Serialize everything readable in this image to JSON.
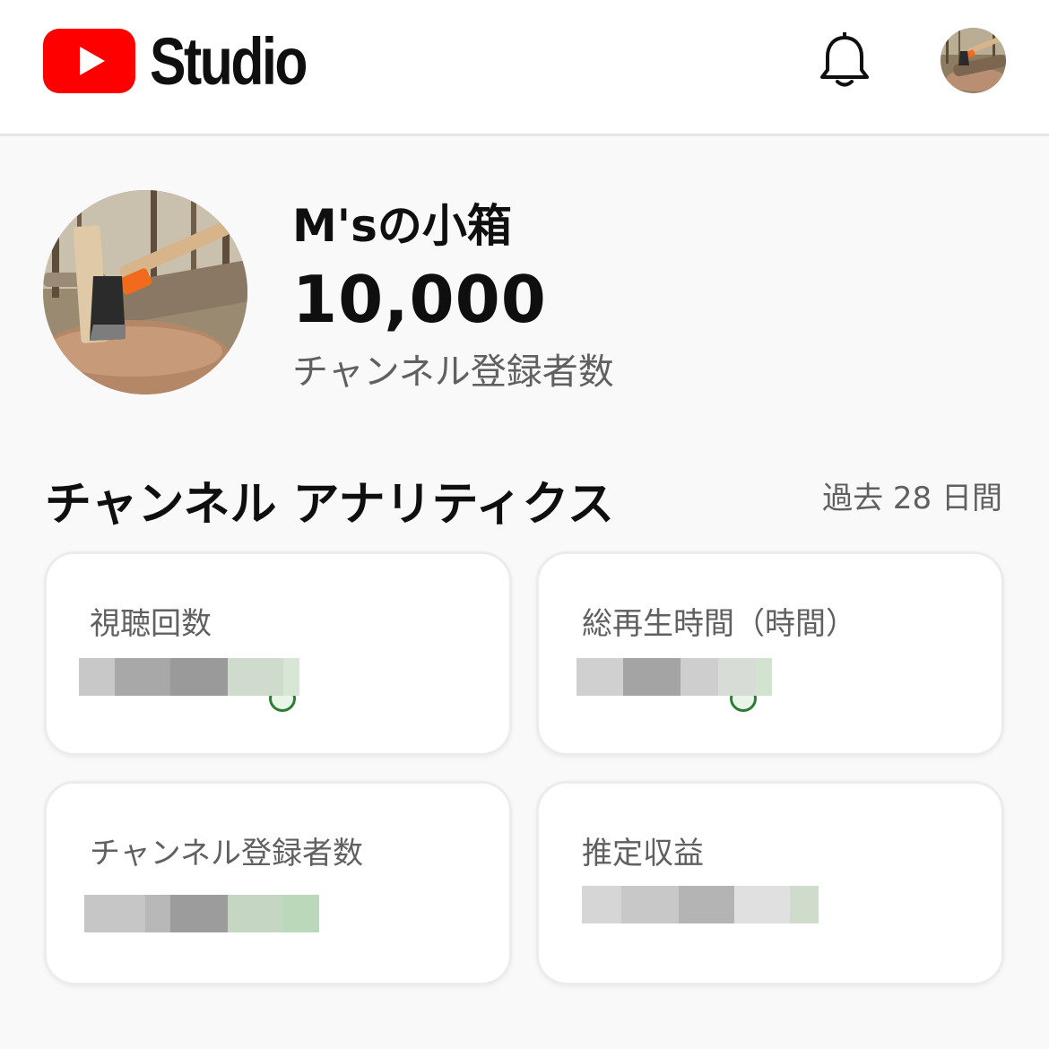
{
  "header": {
    "app_name": "Studio",
    "notification_icon": "bell-icon",
    "avatar_icon": "channel-avatar"
  },
  "channel": {
    "name": "M'sの小箱",
    "subscriber_count": "10,000",
    "subscriber_label": "チャンネル登録者数"
  },
  "analytics": {
    "title": "チャンネル アナリティクス",
    "period": "過去 28 日間",
    "cards": [
      {
        "title": "視聴回数",
        "value": "",
        "trend": "up"
      },
      {
        "title": "総再生時間（時間）",
        "value": "",
        "trend": "up"
      },
      {
        "title": "チャンネル登録者数",
        "value": "",
        "trend": "up"
      },
      {
        "title": "推定収益",
        "value": "",
        "trend": "up"
      }
    ]
  },
  "colors": {
    "brand_red": "#ff0000",
    "trend_green": "#2e7d32",
    "secondary_text": "#606060"
  }
}
